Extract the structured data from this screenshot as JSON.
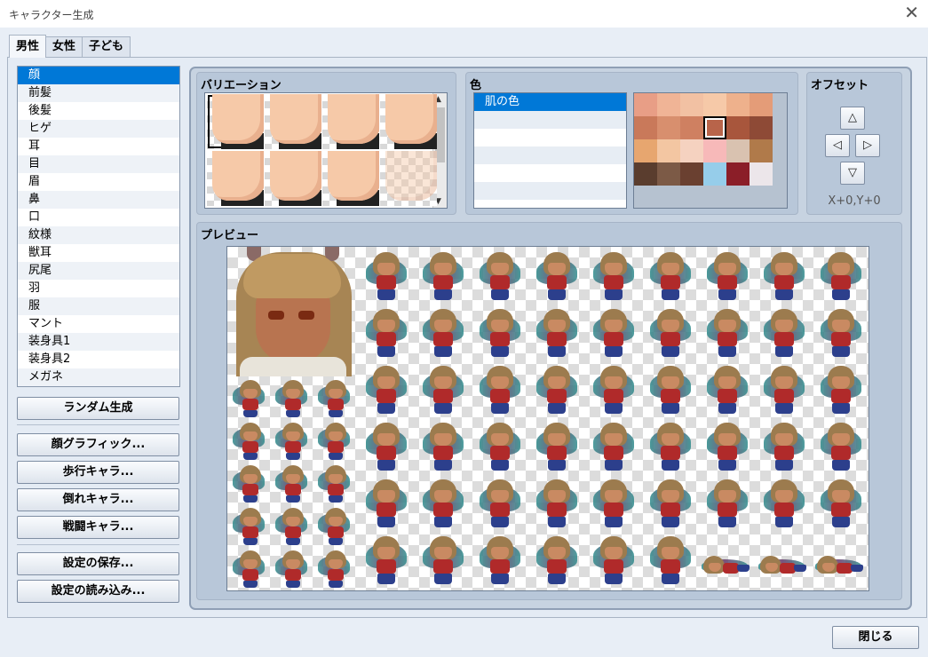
{
  "window": {
    "title": "キャラクター生成",
    "close_glyph": "✕"
  },
  "tabs": [
    {
      "label": "男性",
      "active": true
    },
    {
      "label": "女性",
      "active": false
    },
    {
      "label": "子ども",
      "active": false
    }
  ],
  "parts": [
    "顔",
    "前髪",
    "後髪",
    "ヒゲ",
    "耳",
    "目",
    "眉",
    "鼻",
    "口",
    "紋様",
    "獣耳",
    "尻尾",
    "羽",
    "服",
    "マント",
    "装身具1",
    "装身具2",
    "メガネ"
  ],
  "selected_part": "顔",
  "buttons": {
    "random": "ランダム生成",
    "face_graphic": "顔グラフィック...",
    "walk_char": "歩行キャラ...",
    "down_char": "倒れキャラ...",
    "battle_char": "戦闘キャラ...",
    "save_settings": "設定の保存...",
    "load_settings": "設定の読み込み...",
    "close": "閉じる"
  },
  "variation": {
    "label": "バリエーション",
    "thumbnail_count": 8,
    "selected_index": 0
  },
  "color": {
    "label": "色",
    "items": [
      "肌の色"
    ],
    "selected_item": "肌の色",
    "palette": [
      [
        "#e89e86",
        "#f0b496",
        "#f2c1a3",
        "#f6c9a8",
        "#eeb18c",
        "#e49c78"
      ],
      [
        "#c9795a",
        "#d88f6e",
        "#cf8061",
        "#b8644a",
        "#a8563c",
        "#8e4a36"
      ],
      [
        "#e7a66f",
        "#f3c6a2",
        "#f5d2c0",
        "#f7b9b9",
        "#d9c2b0",
        "#b07a4a"
      ],
      [
        "#5a3d2e",
        "#7c5a46",
        "#6a4030",
        "#96cdea",
        "#8b1e28",
        "#ece6ea"
      ]
    ],
    "selected_swatch": [
      1,
      3
    ]
  },
  "offset": {
    "label": "オフセット",
    "up": "△",
    "left": "◁",
    "right": "▷",
    "down": "▽",
    "value_text": "X+0,Y+0"
  },
  "preview": {
    "label": "プレビュー"
  },
  "colors": {
    "accent": "#0078d7",
    "panel": "#c7d3e1"
  }
}
